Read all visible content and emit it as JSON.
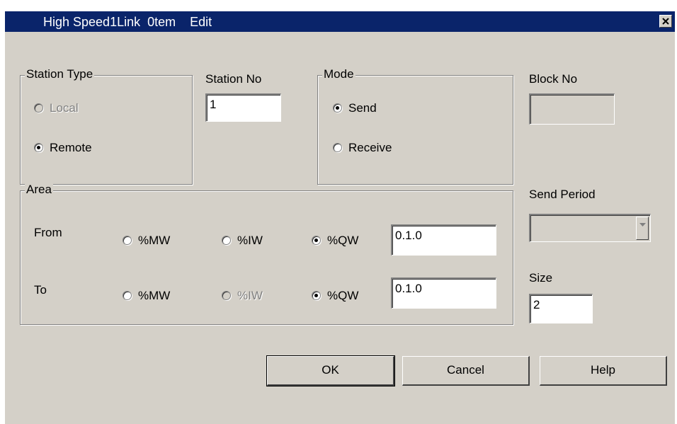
{
  "window": {
    "title": "High Speed1Link  0tem    Edit"
  },
  "station_type": {
    "label": "Station Type",
    "options": [
      {
        "label": "Local",
        "checked": false,
        "disabled": true
      },
      {
        "label": "Remote",
        "checked": true,
        "disabled": false
      }
    ]
  },
  "station_no": {
    "label": "Station No",
    "value": "1"
  },
  "mode": {
    "label": "Mode",
    "options": [
      {
        "label": "Send",
        "checked": true
      },
      {
        "label": "Receive",
        "checked": false
      }
    ]
  },
  "block_no": {
    "label": "Block No",
    "value": ""
  },
  "area": {
    "label": "Area",
    "from": {
      "label": "From",
      "options": [
        {
          "label": "%MW",
          "checked": false,
          "disabled": false
        },
        {
          "label": "%IW",
          "checked": false,
          "disabled": false
        },
        {
          "label": "%QW",
          "checked": true,
          "disabled": false
        }
      ],
      "value": "0.1.0"
    },
    "to": {
      "label": "To",
      "options": [
        {
          "label": "%MW",
          "checked": false,
          "disabled": false
        },
        {
          "label": "%IW",
          "checked": false,
          "disabled": true
        },
        {
          "label": "%QW",
          "checked": true,
          "disabled": false
        }
      ],
      "value": "0.1.0"
    }
  },
  "send_period": {
    "label": "Send Period",
    "value": ""
  },
  "size": {
    "label": "Size",
    "value": "2"
  },
  "buttons": {
    "ok": "OK",
    "cancel": "Cancel",
    "help": "Help"
  }
}
